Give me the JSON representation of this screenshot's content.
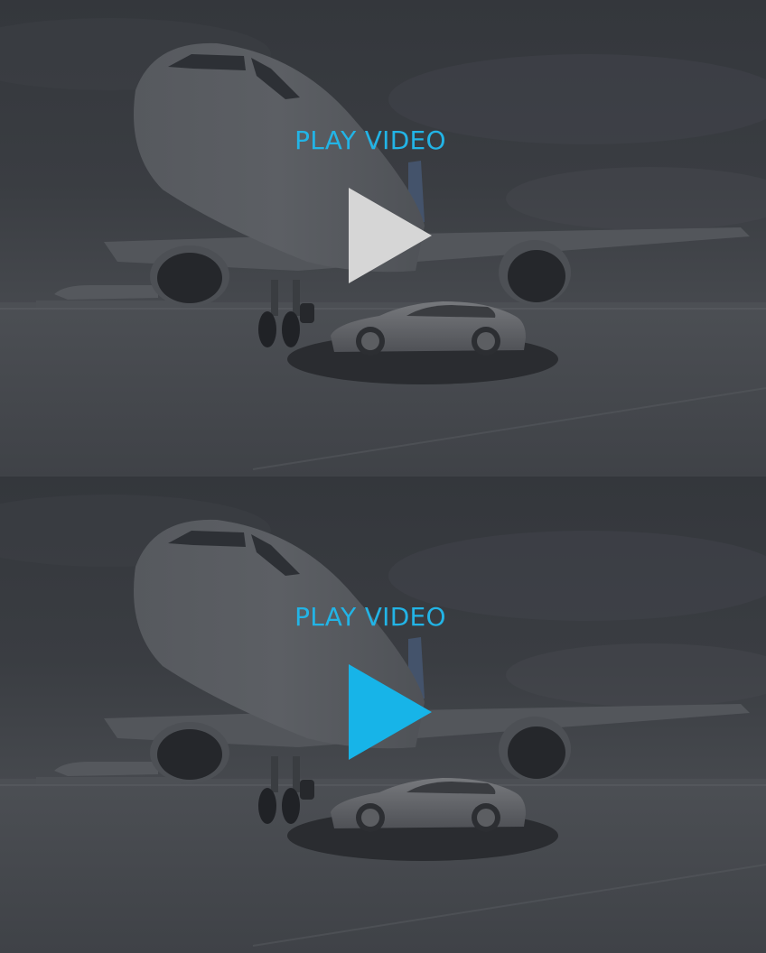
{
  "panels": [
    {
      "state": "default",
      "play_label": "PLAY VIDEO",
      "label_color": "#22b4e6",
      "play_icon_color": "#d6d6d6"
    },
    {
      "state": "hover",
      "play_label": "PLAY VIDEO",
      "label_color": "#22b4e6",
      "play_icon_color": "#17b4e8"
    }
  ],
  "icons": {
    "play": "play-icon"
  },
  "overlay_color": "#2a2c30"
}
